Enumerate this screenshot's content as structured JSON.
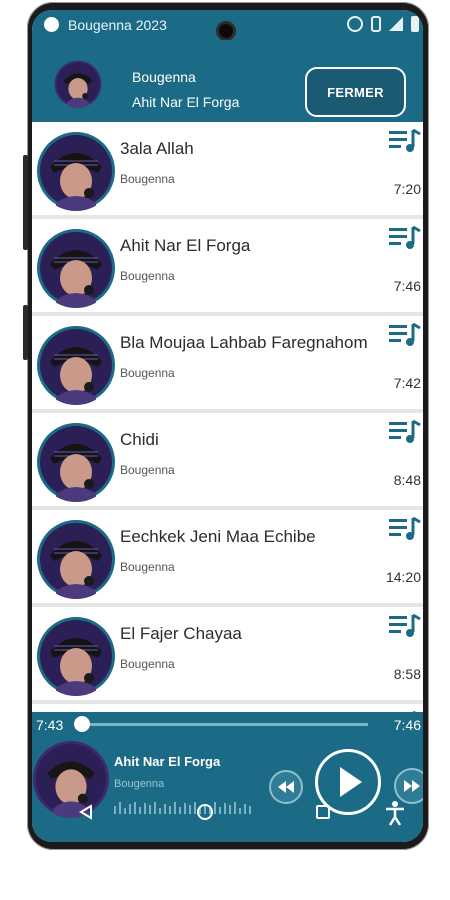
{
  "status_bar": {
    "app_title": "Bougenna 2023",
    "icons": [
      "app-icon",
      "alarm-icon",
      "vibrate-icon",
      "signal-icon",
      "battery-icon"
    ]
  },
  "now_playing_bar": {
    "artist": "Bougenna",
    "title": "Ahit Nar El Forga",
    "close_label": "FERMER"
  },
  "songs": [
    {
      "title": "3ala Allah",
      "artist": "Bougenna",
      "duration": "7:20"
    },
    {
      "title": "Ahit Nar El Forga",
      "artist": "Bougenna",
      "duration": "7:46"
    },
    {
      "title": "Bla Moujaa Lahbab Faregnahom",
      "artist": "Bougenna",
      "duration": "7:42"
    },
    {
      "title": "Chidi",
      "artist": "Bougenna",
      "duration": "8:48"
    },
    {
      "title": "Eechkek Jeni Maa Echibe",
      "artist": "Bougenna",
      "duration": "14:20"
    },
    {
      "title": "El Fajer Chayaa",
      "artist": "Bougenna",
      "duration": "8:58"
    }
  ],
  "player": {
    "current_time": "7:43",
    "total_time": "7:46",
    "title": "Ahit Nar El Forga",
    "artist": "Bougenna",
    "progress_fraction": 0.0
  },
  "colors": {
    "primary": "#1c6b86",
    "queue_icon": "#1c6b86",
    "row_bg": "#ffffff"
  }
}
